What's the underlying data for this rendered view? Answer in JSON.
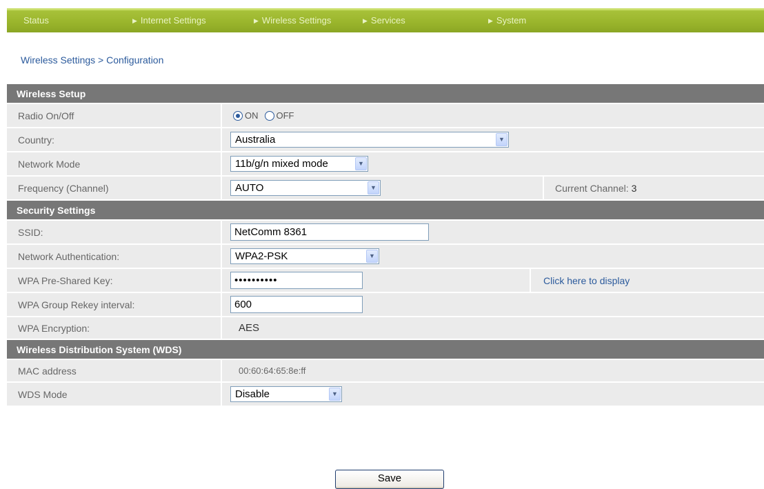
{
  "nav": {
    "items": [
      {
        "label": "Status",
        "arrow": false
      },
      {
        "label": "Internet Settings",
        "arrow": true
      },
      {
        "label": "Wireless Settings",
        "arrow": true
      },
      {
        "label": "Services",
        "arrow": true
      },
      {
        "label": "System",
        "arrow": true
      }
    ]
  },
  "breadcrumb": "Wireless Settings > Configuration",
  "wireless_setup": {
    "heading": "Wireless Setup",
    "radio": {
      "label": "Radio On/Off",
      "on_label": "ON",
      "off_label": "OFF",
      "selected": "ON"
    },
    "country": {
      "label": "Country:",
      "value": "Australia"
    },
    "network_mode": {
      "label": "Network Mode",
      "value": "11b/g/n mixed mode"
    },
    "frequency": {
      "label": "Frequency (Channel)",
      "value": "AUTO",
      "current_label": "Current Channel:",
      "current_value": "3"
    }
  },
  "security": {
    "heading": "Security Settings",
    "ssid": {
      "label": "SSID:",
      "value": "NetComm 8361"
    },
    "auth": {
      "label": "Network Authentication:",
      "value": "WPA2-PSK"
    },
    "psk": {
      "label": "WPA Pre-Shared Key:",
      "value": "••••••••••",
      "link": "Click here to display"
    },
    "rekey": {
      "label": "WPA Group Rekey interval:",
      "value": "600"
    },
    "encryption": {
      "label": "WPA Encryption:",
      "value": "AES"
    }
  },
  "wds": {
    "heading": "Wireless Distribution System (WDS)",
    "mac": {
      "label": "MAC address",
      "value": "00:60:64:65:8e:ff"
    },
    "mode": {
      "label": "WDS Mode",
      "value": "Disable"
    }
  },
  "save_label": "Save",
  "icons": {
    "dropdown": "chevron-down-icon",
    "nav_arrow": "triangle-right-icon"
  },
  "colors": {
    "nav_bar": "#9ab52c",
    "section_header": "#777777",
    "row_bg": "#ebebeb",
    "link": "#2b5a9c"
  }
}
